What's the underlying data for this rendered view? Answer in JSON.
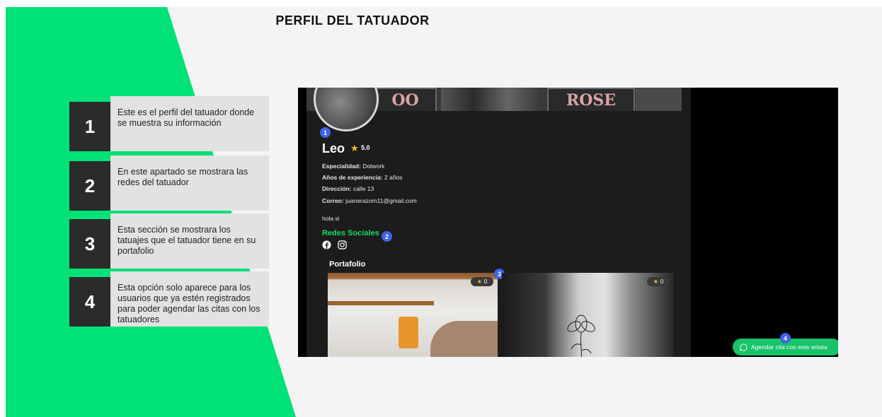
{
  "slide": {
    "title": "PERFIL DEL TATUADOR",
    "accent_color": "#00e278",
    "steps": [
      {
        "number": "1",
        "text": "Este es el perfil del tatuador donde se muestra su información"
      },
      {
        "number": "2",
        "text": "En este apartado se mostrara las redes del tatuador"
      },
      {
        "number": "3",
        "text": "Esta sección se mostrara los tatuajes que el tatuador tiene en su portafolio"
      },
      {
        "number": "4",
        "text": "Esta opción solo aparece para los usuarios que ya estén registrados  para poder agendar las citas con los tatuadores"
      }
    ]
  },
  "app": {
    "banner_sign_1": "OO",
    "banner_sign_2": "ROSE",
    "artist": {
      "name": "Leo",
      "rating": "5.0",
      "specialty_label": "Especialidad:",
      "specialty_value": "Dotwork",
      "experience_label": "Años de experiencia:",
      "experience_value": "2 años",
      "address_label": "Dirección:",
      "address_value": "calle 13",
      "email_label": "Correo:",
      "email_value": "juanerazom11@gmail.com",
      "bio": "hola si"
    },
    "social_title": "Redes Sociales",
    "social_icons": [
      "facebook-icon",
      "instagram-icon"
    ],
    "portfolio_title": "Portafolio",
    "portfolio": [
      {
        "likes": "0"
      },
      {
        "likes": "0"
      }
    ],
    "book_button": "Agendar cita con este artista",
    "markers": [
      "1",
      "2",
      "3",
      "4"
    ]
  }
}
